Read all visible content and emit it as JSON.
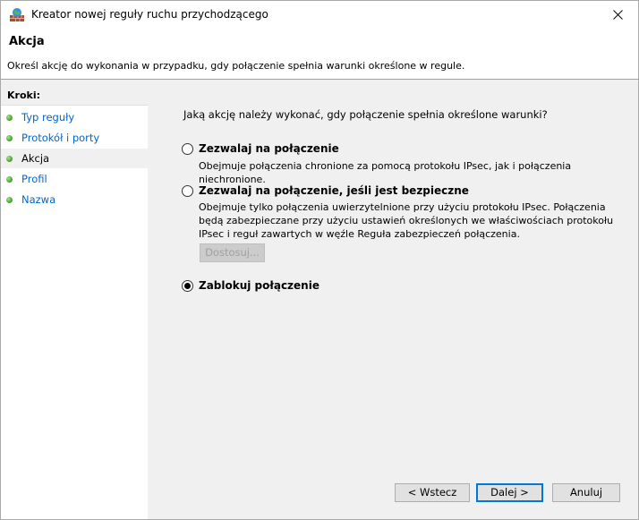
{
  "window": {
    "title": "Kreator nowej reguły ruchu przychodzącego"
  },
  "header": {
    "title": "Akcja",
    "description": "Określ akcję do wykonania w przypadku, gdy połączenie spełnia warunki określone w regule."
  },
  "sidebar": {
    "heading": "Kroki:",
    "items": [
      {
        "label": "Typ reguły",
        "active": false
      },
      {
        "label": "Protokół i porty",
        "active": false
      },
      {
        "label": "Akcja",
        "active": true
      },
      {
        "label": "Profil",
        "active": false
      },
      {
        "label": "Nazwa",
        "active": false
      }
    ]
  },
  "main": {
    "question": "Jaką akcję należy wykonać, gdy połączenie spełnia określone warunki?",
    "options": [
      {
        "label": "Zezwalaj na połączenie",
        "description": "Obejmuje połączenia chronione za pomocą protokołu IPsec, jak i połączenia niechronione.",
        "selected": false
      },
      {
        "label": "Zezwalaj na połączenie, jeśli jest bezpieczne",
        "description": "Obejmuje tylko połączenia uwierzytelnione przy użyciu protokołu IPsec. Połączenia będą zabezpieczane przy użyciu ustawień określonych we właściwościach protokołu IPsec i reguł zawartych w węźle Reguła zabezpieczeń połączenia.",
        "selected": false
      },
      {
        "label": "Zablokuj połączenie",
        "selected": true
      }
    ],
    "customize_label": "Dostosuj..."
  },
  "footer": {
    "back_label": "< Wstecz",
    "next_label": "Dalej >",
    "cancel_label": "Anuluj"
  },
  "colors": {
    "link": "#0066cc",
    "step_dot": "#3aa01e",
    "focus_border": "#0078d7"
  }
}
